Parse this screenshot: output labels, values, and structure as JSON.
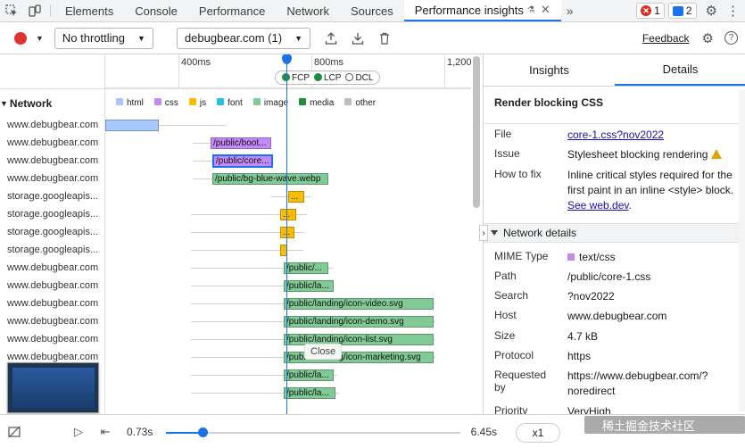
{
  "tabs": [
    "Elements",
    "Console",
    "Performance",
    "Network",
    "Sources",
    "Performance insights"
  ],
  "badges": {
    "errors": "1",
    "messages": "2"
  },
  "toolbar": {
    "throttling": "No throttling",
    "recording": "debugbear.com (1)",
    "feedback": "Feedback"
  },
  "ruler": {
    "ticks": [
      "400ms",
      "800ms",
      "1,200"
    ],
    "markers": [
      "FCP",
      "LCP",
      "DCL"
    ]
  },
  "network": {
    "header": "Network",
    "legend": [
      {
        "label": "html",
        "color": "#a8c7fa"
      },
      {
        "label": "css",
        "color": "#c58af9"
      },
      {
        "label": "js",
        "color": "#fbbc04"
      },
      {
        "label": "font",
        "color": "#24c1e0"
      },
      {
        "label": "image",
        "color": "#81c995"
      },
      {
        "label": "media",
        "color": "#1e8e3e"
      },
      {
        "label": "other",
        "color": "#bdbdbd"
      }
    ],
    "rows": [
      {
        "host": "www.debugbear.com",
        "label": "",
        "type": "html"
      },
      {
        "host": "www.debugbear.com",
        "label": "/public/boot...",
        "type": "css"
      },
      {
        "host": "www.debugbear.com",
        "label": "/public/core...",
        "type": "css"
      },
      {
        "host": "www.debugbear.com",
        "label": "/public/bg-blue-wave.webp",
        "type": "image"
      },
      {
        "host": "storage.googleapis...",
        "label": "...",
        "type": "js"
      },
      {
        "host": "storage.googleapis...",
        "label": "...",
        "type": "js"
      },
      {
        "host": "storage.googleapis...",
        "label": "...",
        "type": "js"
      },
      {
        "host": "storage.googleapis...",
        "label": "",
        "type": "js"
      },
      {
        "host": "www.debugbear.com",
        "label": "/public/...",
        "type": "image"
      },
      {
        "host": "www.debugbear.com",
        "label": "/public/la...",
        "type": "image"
      },
      {
        "host": "www.debugbear.com",
        "label": "/public/landing/icon-video.svg",
        "type": "image"
      },
      {
        "host": "www.debugbear.com",
        "label": "/public/landing/icon-demo.svg",
        "type": "image"
      },
      {
        "host": "www.debugbear.com",
        "label": "/public/landing/icon-list.svg",
        "type": "image"
      },
      {
        "host": "www.debugbear.com",
        "label": "/public/landing/icon-marketing.svg",
        "type": "image"
      },
      {
        "host": "",
        "label": "/public/la...",
        "type": "image"
      },
      {
        "host": "",
        "label": "/public/la...",
        "type": "image"
      }
    ],
    "tooltip": "Close"
  },
  "details": {
    "tabs": [
      "Insights",
      "Details"
    ],
    "title": "Render blocking CSS",
    "file_label": "File",
    "file_value": "core-1.css?nov2022",
    "issue_label": "Issue",
    "issue_value": "Stylesheet blocking rendering",
    "fix_label": "How to fix",
    "fix_value": "Inline critical styles required for the first paint in an inline <style> block.",
    "fix_link": "See web.dev",
    "section": "Network details",
    "items": [
      {
        "k": "MIME Type",
        "v": "text/css"
      },
      {
        "k": "Path",
        "v": "/public/core-1.css"
      },
      {
        "k": "Search",
        "v": "?nov2022"
      },
      {
        "k": "Host",
        "v": "www.debugbear.com"
      },
      {
        "k": "Size",
        "v": "4.7 kB"
      },
      {
        "k": "Protocol",
        "v": "https"
      },
      {
        "k": "Requested by",
        "v": "https://www.debugbear.com/?noredirect"
      },
      {
        "k": "Priority",
        "v": "VeryHigh"
      }
    ]
  },
  "bottom": {
    "start_time": "0.73s",
    "end_time": "6.45s",
    "rate": "x1",
    "watermark": "稀土掘金技术社区"
  }
}
